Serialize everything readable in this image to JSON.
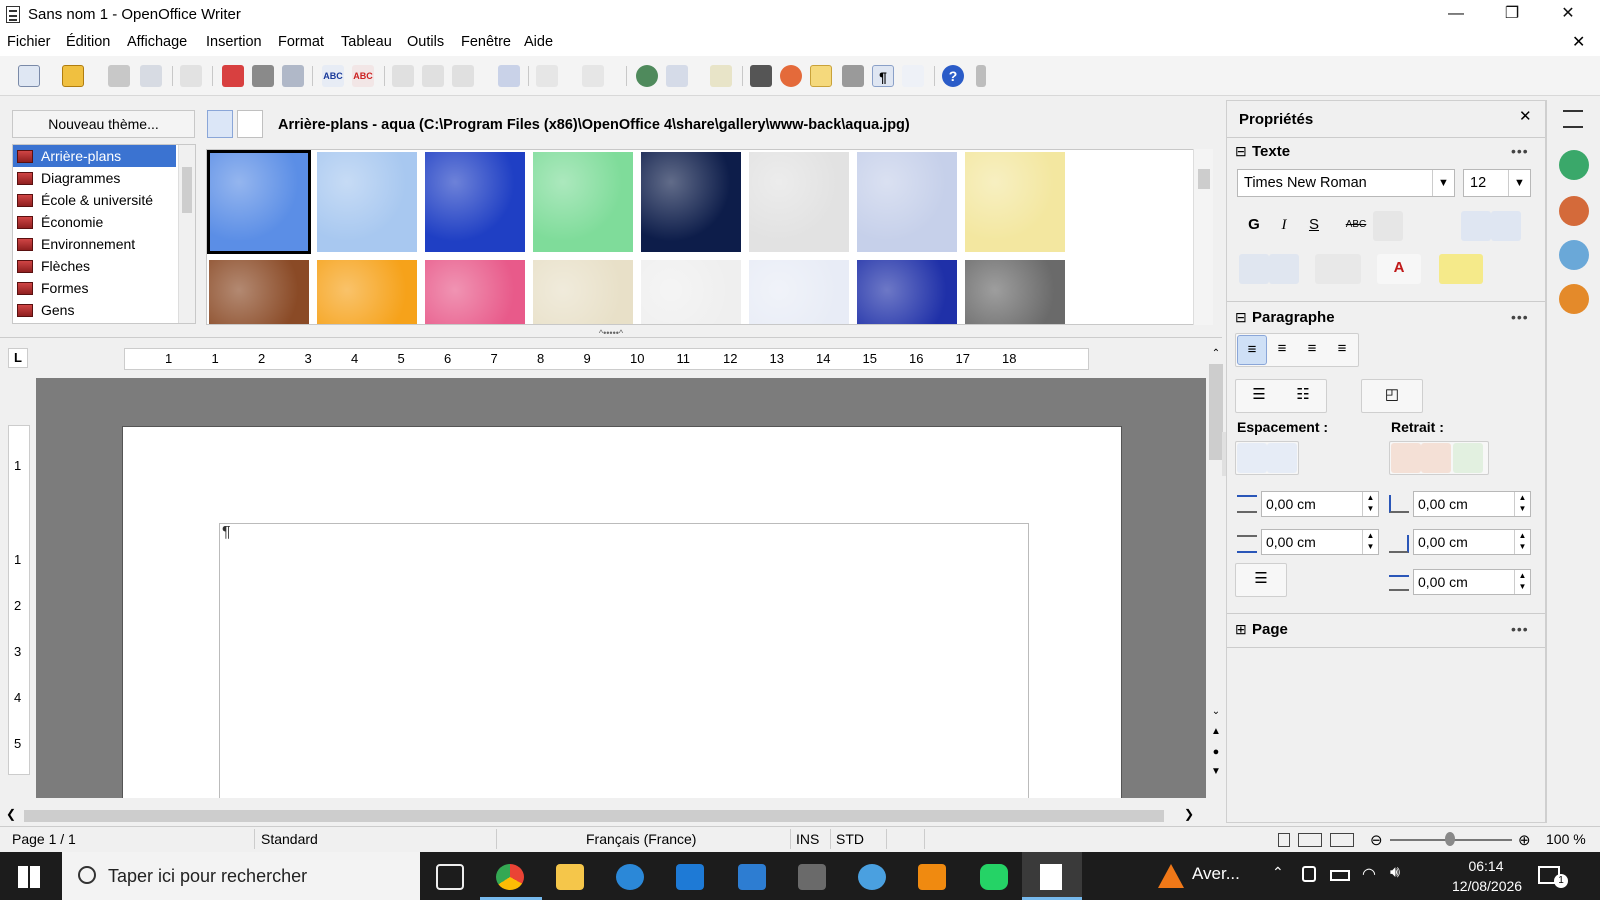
{
  "window": {
    "title": "Sans nom 1 - OpenOffice Writer",
    "minimize": "—",
    "restore": "❐",
    "close": "✕",
    "doc_close": "✕"
  },
  "menu": {
    "items": [
      "Fichier",
      "Édition",
      "Affichage",
      "Insertion",
      "Format",
      "Tableau",
      "Outils",
      "Fenêtre",
      "Aide"
    ]
  },
  "gallery": {
    "new_theme_label": "Nouveau thème...",
    "path": "Arrière-plans - aqua (C:\\Program Files (x86)\\OpenOffice 4\\share\\gallery\\www-back\\aqua.jpg)",
    "themes": [
      "Arrière-plans",
      "Diagrammes",
      "École & université",
      "Économie",
      "Environnement",
      "Flèches",
      "Formes",
      "Gens"
    ],
    "selected_theme": "Arrière-plans",
    "thumb_colors": [
      "#5b8ee6",
      "#a8c8f0",
      "#1f3fc4",
      "#7fdc9a",
      "#0d1d4a",
      "#e2e2e2",
      "#c6d0ea",
      "#f3e7a0",
      "#8a4a26",
      "#f6a21a",
      "#e85a8a",
      "#e8e0c8",
      "#efefef",
      "#e8ecf6",
      "#1f30a8",
      "#6a6a6a"
    ]
  },
  "ruler": {
    "numbers": [
      "1",
      "1",
      "2",
      "3",
      "4",
      "5",
      "6",
      "7",
      "8",
      "9",
      "10",
      "11",
      "12",
      "13",
      "14",
      "15",
      "16",
      "17",
      "18"
    ],
    "vnumbers": [
      "1",
      "1",
      "2",
      "3",
      "4",
      "5"
    ],
    "tab_marker": "L"
  },
  "document": {
    "pilcrow": "¶"
  },
  "sidebar": {
    "title": "Propriétés",
    "close": "✕",
    "text_section": "Texte",
    "font_name": "Times New Roman",
    "font_size": "12",
    "bold": "G",
    "italic": "I",
    "underline": "S",
    "strike": "ABC",
    "paragraph_section": "Paragraphe",
    "spacing_label": "Espacement :",
    "indent_label": "Retrait :",
    "spacing_above": "0,00 cm",
    "spacing_below": "0,00 cm",
    "indent_before": "0,00 cm",
    "indent_after": "0,00 cm",
    "indent_first": "0,00 cm",
    "page_section": "Page",
    "more": "•••",
    "collapse": "⊟",
    "expand": "⊞"
  },
  "status": {
    "page": "Page 1 / 1",
    "style": "Standard",
    "language": "Français (France)",
    "ins": "INS",
    "std": "STD",
    "zoom": "100 %"
  },
  "taskbar": {
    "search_placeholder": "Taper ici pour rechercher",
    "avast": "Aver...",
    "time": "06:14",
    "date": "12/08/2026",
    "notif_count": "1"
  }
}
